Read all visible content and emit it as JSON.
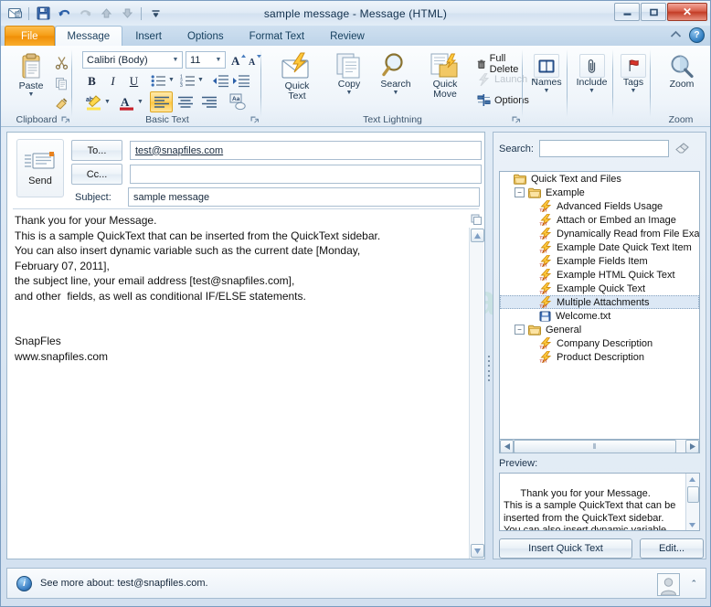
{
  "window": {
    "title": "sample message  -  Message (HTML)",
    "minimize_label": "–",
    "maximize_label": "□",
    "close_label": "✕"
  },
  "quick_access": {
    "items": [
      {
        "name": "outlook-icon",
        "glyph": "✉"
      },
      {
        "name": "save-icon",
        "glyph": "💾"
      },
      {
        "name": "undo-icon",
        "glyph": "↶"
      },
      {
        "name": "redo-icon",
        "glyph": "↻"
      },
      {
        "name": "previous-item-icon",
        "glyph": "▲"
      },
      {
        "name": "next-item-icon",
        "glyph": "▼"
      },
      {
        "name": "customize-toolbar-icon",
        "glyph": "∇"
      }
    ]
  },
  "tabs": [
    {
      "label": "File",
      "kind": "file"
    },
    {
      "label": "Message",
      "kind": "active"
    },
    {
      "label": "Insert",
      "kind": "normal"
    },
    {
      "label": "Options",
      "kind": "normal"
    },
    {
      "label": "Format Text",
      "kind": "normal"
    },
    {
      "label": "Review",
      "kind": "normal"
    }
  ],
  "tabbar_right": {
    "collapse_ribbon": "⌃",
    "help": "?"
  },
  "ribbon": {
    "clipboard": {
      "group_label": "Clipboard",
      "paste_label": "Paste",
      "cut_label": "✂",
      "copy_label": "⧉",
      "format_painter_label": "🖌",
      "launcher": "⬌"
    },
    "basic_text": {
      "group_label": "Basic Text",
      "font_name": "Calibri (Body)",
      "font_size": "11",
      "grow_font": "A",
      "shrink_font": "A",
      "bold": "B",
      "italic": "I",
      "underline": "U",
      "bullets": "☰",
      "numbering": "☰",
      "decrease_indent": "≡",
      "increase_indent": "≡",
      "highlight": "ab",
      "font_color": "A",
      "align_left": "≡",
      "align_center": "≡",
      "align_right": "≡",
      "clear_formatting": "Aa",
      "launcher": "⬌"
    },
    "text_lightning": {
      "group_label": "Text Lightning",
      "quick_text_label": "Quick\nText",
      "copy_label": "Copy",
      "search_label": "Search",
      "quick_move_label": "Quick\nMove",
      "full_delete_label": "Full Delete",
      "launch_label": "Launch",
      "options_label": "Options",
      "launcher": "⬌"
    },
    "names": {
      "group_label": "",
      "label": "Names"
    },
    "include": {
      "group_label": "",
      "label": "Include"
    },
    "tags": {
      "group_label": "",
      "label": "Tags"
    },
    "zoom": {
      "group_label": "Zoom",
      "label": "Zoom"
    }
  },
  "compose": {
    "send_label": "Send",
    "to_label": "To...",
    "cc_label": "Cc...",
    "subject_label": "Subject:",
    "to_value": "test@snapfiles.com",
    "cc_value": "",
    "subject_value": "sample message",
    "body": "Thank you for your Message.\nThis is a sample QuickText that can be inserted from the QuickText sidebar.\nYou can also insert dynamic variable such as the current date [Monday,\nFebruary 07, 2011],\nthe subject line, your email address [test@snapfiles.com],\nand other  fields, as well as conditional IF/ELSE statements.\n\n\nSnapFles\nwww.snapfiles.com",
    "scroll_up": "▲",
    "scroll_down": "▼"
  },
  "sidebar": {
    "search_label": "Search:",
    "search_value": "",
    "search_placeholder": "",
    "eraser_icon": "▱",
    "tree": [
      {
        "label": "Quick Text and Files",
        "depth": 0,
        "icon": "folder",
        "toggle": "",
        "selected": false
      },
      {
        "label": "Example",
        "depth": 1,
        "icon": "folder",
        "toggle": "−",
        "selected": false
      },
      {
        "label": "Advanced Fields Usage",
        "depth": 2,
        "icon": "quicktext",
        "toggle": "",
        "selected": false
      },
      {
        "label": "Attach or Embed an Image",
        "depth": 2,
        "icon": "quicktext",
        "toggle": "",
        "selected": false
      },
      {
        "label": "Dynamically Read from File Exam",
        "depth": 2,
        "icon": "quicktext",
        "toggle": "",
        "selected": false
      },
      {
        "label": "Example Date Quick Text Item",
        "depth": 2,
        "icon": "quicktext",
        "toggle": "",
        "selected": false
      },
      {
        "label": "Example Fields Item",
        "depth": 2,
        "icon": "quicktext",
        "toggle": "",
        "selected": false
      },
      {
        "label": "Example HTML Quick Text",
        "depth": 2,
        "icon": "quicktext",
        "toggle": "",
        "selected": false
      },
      {
        "label": "Example Quick Text",
        "depth": 2,
        "icon": "quicktext",
        "toggle": "",
        "selected": false
      },
      {
        "label": "Multiple Attachments",
        "depth": 2,
        "icon": "quicktext",
        "toggle": "",
        "selected": true
      },
      {
        "label": "Welcome.txt",
        "depth": 2,
        "icon": "file",
        "toggle": "",
        "selected": false
      },
      {
        "label": "General",
        "depth": 1,
        "icon": "folder",
        "toggle": "−",
        "selected": false
      },
      {
        "label": "Company Description",
        "depth": 2,
        "icon": "quicktext",
        "toggle": "",
        "selected": false
      },
      {
        "label": "Product Description",
        "depth": 2,
        "icon": "quicktext",
        "toggle": "",
        "selected": false
      }
    ],
    "hscroll": {
      "left_arrow": "◀",
      "right_arrow": "▶",
      "thumb_grip": "⫴"
    },
    "preview_label": "Preview:",
    "preview_text": "Thank you for your Message.\nThis is a sample QuickText that can be\ninserted from the QuickText sidebar.\nYou can also insert dynamic variable",
    "preview_scroll_up": "▲",
    "preview_scroll_down": "▼",
    "insert_button": "Insert Quick Text",
    "edit_button": "Edit..."
  },
  "statusbar": {
    "text": "See more about: test@snapfiles.com.",
    "info_icon": "i",
    "expand_icon": "⌃"
  },
  "watermark": "Snap",
  "colors": {
    "accent_orange": "#f59b12",
    "close_red": "#c33c26",
    "selection_blue": "#dce8f5",
    "window_border": "#7a9cc0"
  }
}
